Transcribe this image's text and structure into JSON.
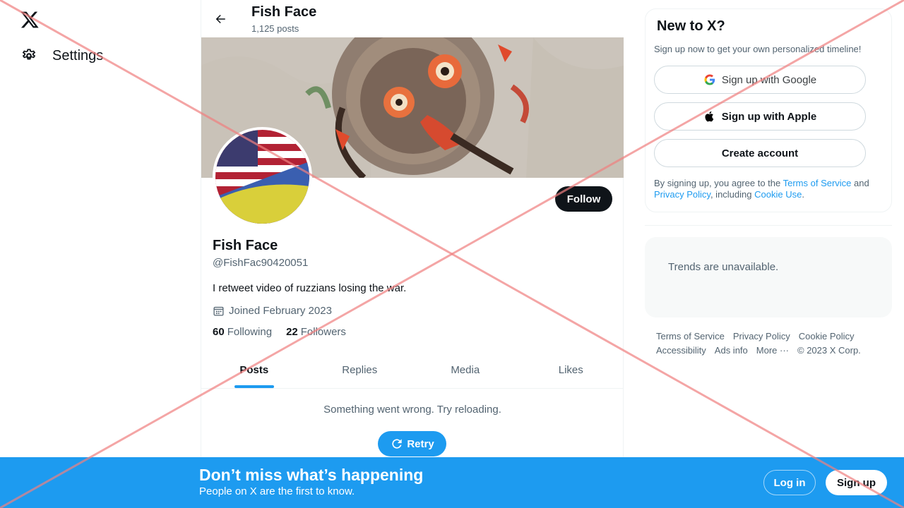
{
  "nav": {
    "logo_icon": "x-logo-icon",
    "settings_label": "Settings"
  },
  "header": {
    "name": "Fish Face",
    "posts_count": "1,125 posts"
  },
  "profile": {
    "name": "Fish Face",
    "handle": "@FishFac90420051",
    "bio": "I retweet video of ruzzians losing the war.",
    "joined": "Joined February 2023",
    "following_count": "60",
    "following_label": "Following",
    "followers_count": "22",
    "followers_label": "Followers",
    "follow_label": "Follow"
  },
  "tabs": [
    {
      "label": "Posts",
      "active": true
    },
    {
      "label": "Replies",
      "active": false
    },
    {
      "label": "Media",
      "active": false
    },
    {
      "label": "Likes",
      "active": false
    }
  ],
  "feed": {
    "error_text": "Something went wrong. Try reloading.",
    "retry_label": "Retry"
  },
  "signup_card": {
    "title": "New to X?",
    "subtitle": "Sign up now to get your own personalized timeline!",
    "google_label": "Sign up with Google",
    "apple_label": "Sign up with Apple",
    "create_label": "Create account",
    "terms_prefix": "By signing up, you agree to the ",
    "terms_link": "Terms of Service",
    "terms_and": " and ",
    "privacy_link": "Privacy Policy",
    "including": ", including ",
    "cookie_link": "Cookie Use",
    "period": "."
  },
  "trends": {
    "text": "Trends are unavailable."
  },
  "footer": {
    "row1": [
      "Terms of Service",
      "Privacy Policy",
      "Cookie Policy"
    ],
    "row2": [
      "Accessibility",
      "Ads info",
      "More ···"
    ],
    "copyright": "© 2023 X Corp."
  },
  "bottom_bar": {
    "title": "Don’t miss what’s happening",
    "subtitle": "People on X are the first to know.",
    "login_label": "Log in",
    "signup_label": "Sign up"
  },
  "colors": {
    "accent": "#1d9bf0",
    "text_primary": "#0f1419",
    "text_secondary": "#536471",
    "overlay_x": "#f08080"
  }
}
